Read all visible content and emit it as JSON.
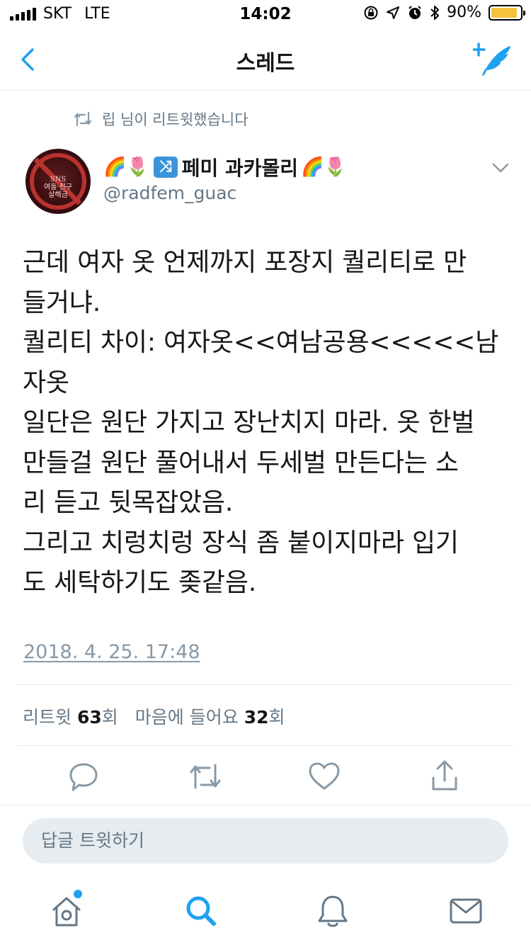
{
  "status_bar": {
    "carrier": "SKT",
    "network": "LTE",
    "time": "14:02",
    "battery_percent": "90%",
    "battery_level": 0.9,
    "icons": [
      "orientation-lock-icon",
      "location-icon",
      "alarm-icon",
      "bluetooth-icon"
    ]
  },
  "nav": {
    "title": "스레드",
    "back_icon": "chevron-left-icon",
    "compose_icon": "compose-tweet-icon"
  },
  "retweet_context": {
    "text": "립 님이 리트윗했습니다",
    "icon": "retweet-icon"
  },
  "tweet": {
    "display_name_emoji_left": "🌈🌷",
    "shuffle_emoji": "🔀",
    "display_name": "페미 과카몰리",
    "display_name_emoji_right": "🌈🌷",
    "handle": "@radfem_guac",
    "avatar_text": "SNS\n여돌·친구\n살해금",
    "text": "근데 여자 옷 언제까지 포장지 퀄리티로 만\n들거냐.\n퀄리티 차이: 여자옷<<여남공용<<<<<남\n자옷\n일단은 원단 가지고 장난치지 마라. 옷 한벌\n만들걸 원단 풀어내서 두세벌 만든다는 소\n리 듣고 뒷목잡았음.\n그리고 치렁치렁 장식 좀 붙이지마라 입기\n도 세탁하기도 좆같음.",
    "timestamp": "2018. 4. 25. 17:48"
  },
  "stats": {
    "retweet_label": "리트윗",
    "retweet_count": "63",
    "retweet_unit": "회",
    "like_label": "마음에 들어요",
    "like_count": "32",
    "like_unit": "회"
  },
  "actions": [
    "reply-icon",
    "retweet-icon",
    "like-icon",
    "share-icon"
  ],
  "reply_box": {
    "placeholder": "답글 트윗하기"
  },
  "tabbar": {
    "tabs": [
      "home-icon",
      "search-icon",
      "notifications-icon",
      "messages-icon"
    ],
    "active": "search-icon"
  },
  "colors": {
    "accent": "#1da1f2",
    "text": "#14171a",
    "secondary": "#657786",
    "divider": "#e1e8ed",
    "battery": "#f5c33b"
  }
}
